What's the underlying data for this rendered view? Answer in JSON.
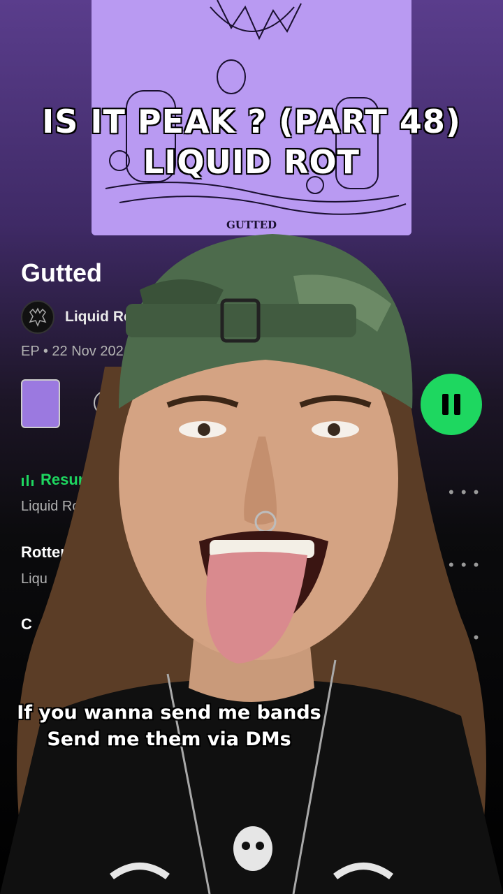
{
  "overlay": {
    "title_line1": "IS IT PEAK ? (PART 48)",
    "title_line2": "LIQUID ROT",
    "caption_line1": "If you wanna send me bands",
    "caption_line2": "Send me them via DMs"
  },
  "album": {
    "art_text": "GUTTED",
    "name": "Gutted",
    "artist": "Liquid Ro",
    "meta": "EP • 22 Nov 202"
  },
  "controls": {
    "add_icon": "plus-circle-icon",
    "play_state": "pause-icon"
  },
  "tracks": [
    {
      "title": "Resur",
      "artist": "Liquid Ro",
      "playing": true
    },
    {
      "title": "Rotter",
      "artist": "Liqu",
      "playing": false
    },
    {
      "title": "C",
      "artist": "",
      "playing": false
    }
  ],
  "colors": {
    "accent": "#1ed760",
    "album_bg": "#b99af2",
    "gradient_top": "#5a3d8c"
  }
}
